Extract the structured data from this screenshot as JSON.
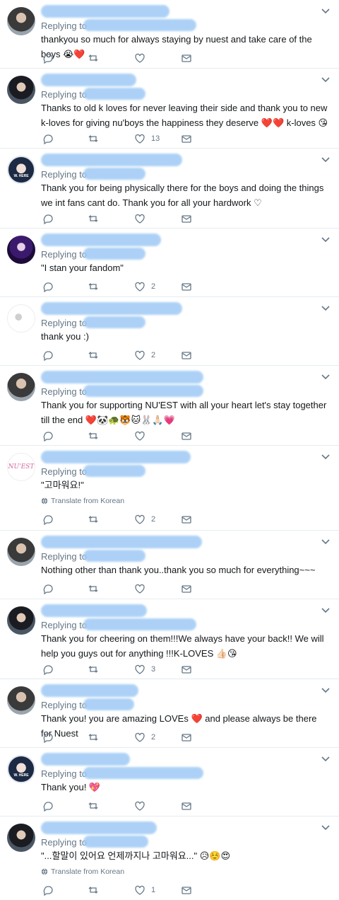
{
  "common": {
    "replying_to": "Replying to",
    "translate_label": "Translate from Korean"
  },
  "tweets": [
    {
      "text": "thankyou so much for always staying by nuest and take care of the boys 😭❤️",
      "likes": ""
    },
    {
      "text": "Thanks to old k loves for never leaving their side and thank you to new k-loves for giving nu'boys the happiness they deserve ❤️❤️ k-loves 😘",
      "likes": "13"
    },
    {
      "text": "Thank you for being physically there for the boys and doing the things we int fans cant do. Thank you for all your hardwork ♡",
      "likes": ""
    },
    {
      "text": "\"I stan your fandom\"",
      "likes": "2"
    },
    {
      "text": "thank you :)",
      "likes": "2"
    },
    {
      "text": "Thank you for supporting NU'EST with all your heart let's stay together till the end ❤️🐼🐢🐯🐱🐰🙏🏻💗",
      "likes": ""
    },
    {
      "text": "\"고마워요!\"",
      "likes": "2",
      "translate": true
    },
    {
      "text": "Nothing other than thank you..thank you so much for everything~~~",
      "likes": ""
    },
    {
      "text": "Thank you for cheering on them!!!We always have your back!! We will help you guys out for anything !!!K-LOVES 👍🏻😘",
      "likes": "3"
    },
    {
      "text": "Thank you! you are amazing LOVEs ❤️ and please always be there for Nuest",
      "likes": "2"
    },
    {
      "text": "Thank you! 💖",
      "likes": ""
    },
    {
      "text": "\"...할말이 있어요 언제까지나 고마워요...\" 😥☺️😍",
      "likes": "1",
      "translate": true
    }
  ],
  "icons": {
    "reply": "reply-icon",
    "retweet": "retweet-icon",
    "like": "heart-icon",
    "message": "envelope-icon",
    "more": "chevron-down-icon",
    "translate": "globe-icon"
  },
  "colors": {
    "secondary_text": "#657786",
    "divider": "#e6ecf0",
    "redaction": "#9fcaf5"
  }
}
